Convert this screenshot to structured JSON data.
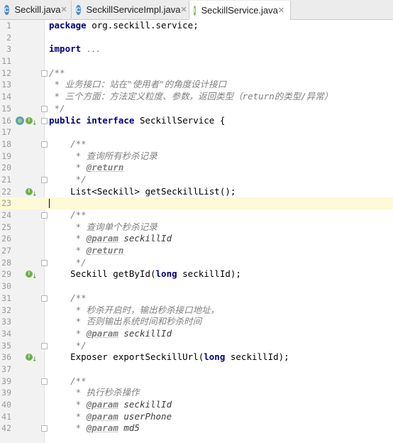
{
  "tabs": [
    {
      "label": "Seckill.java",
      "icon": "C"
    },
    {
      "label": "SeckillServiceImpl.java",
      "icon": "C"
    },
    {
      "label": "SeckillService.java",
      "icon": "I"
    }
  ],
  "lines": [
    {
      "n": "1",
      "h": "<span class='kw'>package</span> org.seckill.service;"
    },
    {
      "n": "2",
      "h": ""
    },
    {
      "n": "3",
      "h": "<span class='kw'>import</span> <span class='fold'>...</span>"
    },
    {
      "n": "11",
      "h": ""
    },
    {
      "n": "12",
      "h": "<span class='cm'>/**</span>"
    },
    {
      "n": "13",
      "h": "<span class='cm'> * 业务接口：站在\"使用者\"的角度设计接口</span>"
    },
    {
      "n": "14",
      "h": "<span class='cm'> * 三个方面：方法定义粒度、参数，返回类型（return的类型/异常）</span>"
    },
    {
      "n": "15",
      "h": "<span class='cm'> */</span>"
    },
    {
      "n": "16",
      "h": "<span class='kw'>public interface</span> SeckillService {"
    },
    {
      "n": "17",
      "h": ""
    },
    {
      "n": "18",
      "h": "    <span class='cm'>/**</span>"
    },
    {
      "n": "19",
      "h": "<span class='cm'>     * 查询所有秒杀记录</span>"
    },
    {
      "n": "20",
      "h": "<span class='cm'>     * </span><span class='tag'>@return</span>"
    },
    {
      "n": "21",
      "h": "<span class='cm'>     */</span>"
    },
    {
      "n": "22",
      "h": "    List&lt;Seckill&gt; getSeckillList();"
    },
    {
      "n": "23",
      "h": ""
    },
    {
      "n": "24",
      "h": "    <span class='cm'>/**</span>"
    },
    {
      "n": "25",
      "h": "<span class='cm'>     * 查询单个秒杀记录</span>"
    },
    {
      "n": "26",
      "h": "<span class='cm'>     * </span><span class='tag'>@param</span> <span class='pv'>seckillId</span>"
    },
    {
      "n": "27",
      "h": "<span class='cm'>     * </span><span class='tag'>@return</span>"
    },
    {
      "n": "28",
      "h": "<span class='cm'>     */</span>"
    },
    {
      "n": "29",
      "h": "    Seckill getById(<span class='kw'>long</span> seckillId);"
    },
    {
      "n": "30",
      "h": ""
    },
    {
      "n": "31",
      "h": "    <span class='cm'>/**</span>"
    },
    {
      "n": "32",
      "h": "<span class='cm'>     * 秒杀开启时，输出秒杀接口地址，</span>"
    },
    {
      "n": "33",
      "h": "<span class='cm'>     * 否则输出系统时间和秒杀时间</span>"
    },
    {
      "n": "34",
      "h": "<span class='cm'>     * </span><span class='tag'>@param</span> <span class='pv'>seckillId</span>"
    },
    {
      "n": "35",
      "h": "<span class='cm'>     */</span>"
    },
    {
      "n": "36",
      "h": "    Exposer exportSeckillUrl(<span class='kw'>long</span> seckillId);"
    },
    {
      "n": "37",
      "h": ""
    },
    {
      "n": "39",
      "h": "    <span class='cm'>/**</span>"
    },
    {
      "n": "39",
      "h": "<span class='cm'>     * 执行秒杀操作</span>"
    },
    {
      "n": "40",
      "h": "<span class='cm'>     * </span><span class='tag'>@param</span> <span class='pv'>seckillId</span>"
    },
    {
      "n": "41",
      "h": "<span class='cm'>     * </span><span class='tag'>@param</span> <span class='pv'>userPhone</span>"
    },
    {
      "n": "42",
      "h": "<span class='cm'>     * </span><span class='tag'>@param</span> <span class='pv'>md5</span>"
    }
  ],
  "current_line_index": 15,
  "impl_markers": [
    8,
    14,
    21,
    28
  ],
  "fold_markers": [
    4,
    7,
    8,
    10,
    13,
    16,
    20,
    23,
    27,
    30,
    34
  ]
}
